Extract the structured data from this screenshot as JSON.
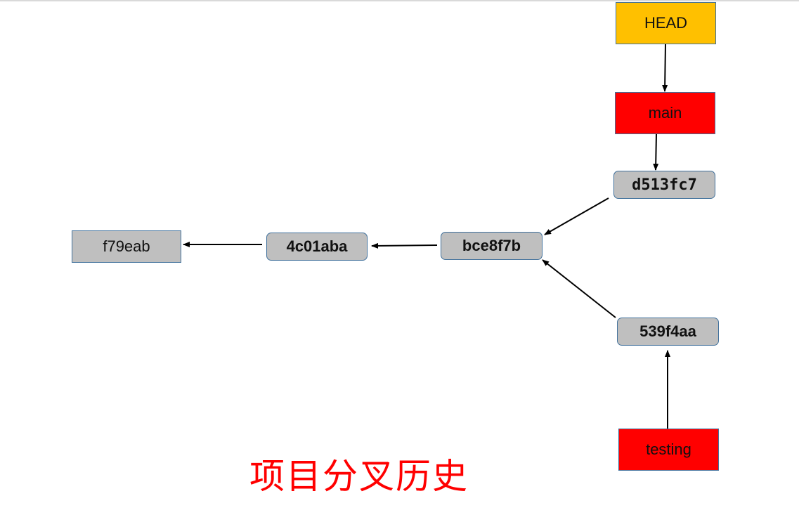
{
  "colors": {
    "head": "#ffc000",
    "branch": "#ff0000",
    "commit": "#bfbfbf",
    "border": "#41719c",
    "arrow": "#000000",
    "caption": "#ff0000"
  },
  "refs": {
    "head": "HEAD",
    "main": "main",
    "testing": "testing"
  },
  "commits": {
    "c1": "f79eab",
    "c2": "4c01aba",
    "c3": "bce8f7b",
    "c4": "d513fc7",
    "c5": "539f4aa"
  },
  "edges": [
    {
      "from": "HEAD",
      "to": "main"
    },
    {
      "from": "main",
      "to": "d513fc7"
    },
    {
      "from": "d513fc7",
      "to": "bce8f7b"
    },
    {
      "from": "539f4aa",
      "to": "bce8f7b"
    },
    {
      "from": "testing",
      "to": "539f4aa"
    },
    {
      "from": "bce8f7b",
      "to": "4c01aba"
    },
    {
      "from": "4c01aba",
      "to": "f79eab"
    }
  ],
  "caption": "项目分叉历史"
}
